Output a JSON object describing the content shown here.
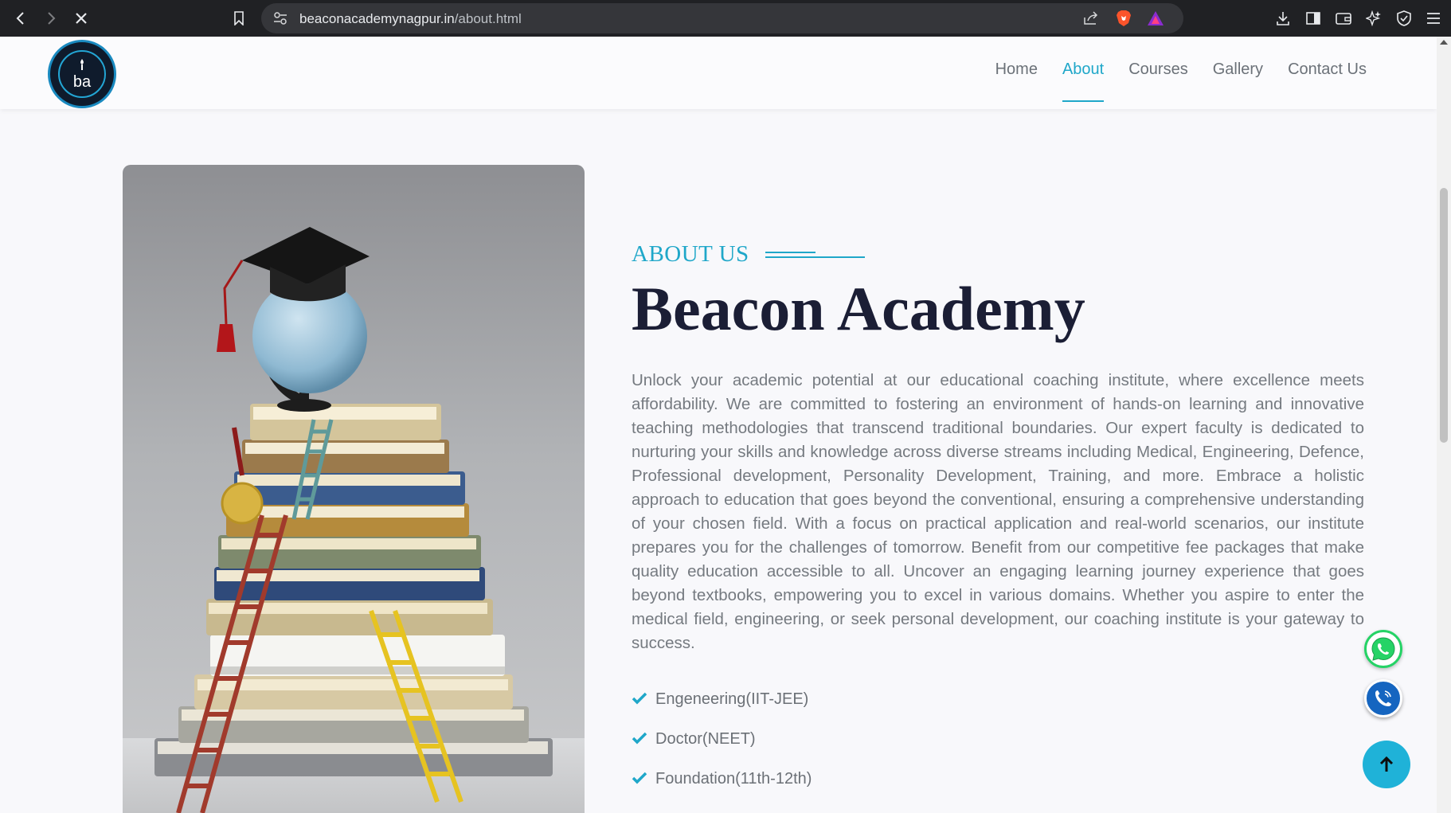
{
  "browser": {
    "url_domain": "beaconacademynagpur.in",
    "url_path": "/about.html"
  },
  "header": {
    "logo_text": "ba",
    "nav": [
      {
        "label": "Home",
        "active": false
      },
      {
        "label": "About",
        "active": true
      },
      {
        "label": "Courses",
        "active": false
      },
      {
        "label": "Gallery",
        "active": false
      },
      {
        "label": "Contact Us",
        "active": false
      }
    ]
  },
  "about": {
    "eyebrow": "ABOUT US",
    "title": "Beacon Academy",
    "description": "Unlock your academic potential at our educational coaching institute, where excellence meets affordability. We are committed to fostering an environment of hands-on learning and innovative teaching methodologies that transcend traditional boundaries. Our expert faculty is dedicated to nurturing your skills and knowledge across diverse streams including Medical, Engineering, Defence, Professional development, Personality Development, Training, and more. Embrace a holistic approach to education that goes beyond the conventional, ensuring a comprehensive understanding of your chosen field. With a focus on practical application and real-world scenarios, our institute prepares you for the challenges of tomorrow. Benefit from our competitive fee packages that make quality education accessible to all. Uncover an engaging learning journey experience that goes beyond textbooks, empowering you to excel in various domains. Whether you aspire to enter the medical field, engineering, or seek personal development, our coaching institute is your gateway to success.",
    "features": [
      "Engeneering(IIT-JEE)",
      "Doctor(NEET)",
      "Foundation(11th-12th)"
    ]
  },
  "colors": {
    "accent": "#1fa7c9",
    "heading": "#1b1e35",
    "whatsapp": "#25d366",
    "call": "#1565c0"
  },
  "icons": {
    "back": "back-arrow-icon",
    "forward": "forward-arrow-icon",
    "stop": "close-icon",
    "bookmark": "bookmark-icon",
    "site_info": "site-settings-icon",
    "share": "share-icon",
    "brave": "brave-shield-icon",
    "rewards": "rewards-icon",
    "download": "download-icon",
    "sidebar": "sidebar-icon",
    "wallet": "wallet-icon",
    "leo": "ai-sparkle-icon",
    "vpn": "vpn-shield-icon",
    "menu": "hamburger-menu-icon"
  }
}
